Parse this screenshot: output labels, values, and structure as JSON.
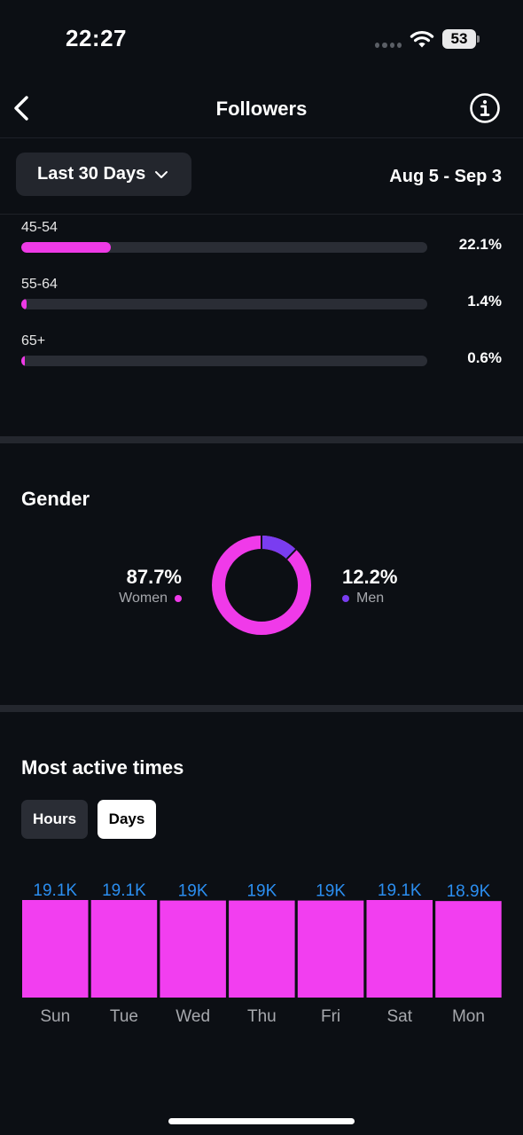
{
  "status_bar": {
    "time": "22:27",
    "battery": "53"
  },
  "header": {
    "title": "Followers",
    "back_icon": "chevron-left-icon",
    "info_icon": "info-circle-icon"
  },
  "range": {
    "selected": "Last 30 Days",
    "dates": "Aug 5 - Sep 3"
  },
  "age_groups": [
    {
      "label": "45-54",
      "value": "22.1%",
      "fraction": 0.221
    },
    {
      "label": "55-64",
      "value": "1.4%",
      "fraction": 0.014
    },
    {
      "label": "65+",
      "value": "0.6%",
      "fraction": 0.006
    }
  ],
  "gender": {
    "title": "Gender",
    "women": {
      "value": "87.7%",
      "label": "Women",
      "fraction": 0.877,
      "color": "#f03ae9"
    },
    "men": {
      "value": "12.2%",
      "label": "Men",
      "fraction": 0.122,
      "color": "#7a3df0"
    }
  },
  "active_times": {
    "title": "Most active times",
    "tabs": {
      "hours": "Hours",
      "days": "Days",
      "selected": "Days"
    }
  },
  "colors": {
    "accent": "#ee3ae6",
    "bar": "#f23ef0",
    "bar_label": "#2b8ef0",
    "background": "#0c0f14"
  },
  "chart_data": {
    "type": "bar",
    "categories": [
      "Sun",
      "Tue",
      "Wed",
      "Thu",
      "Fri",
      "Sat",
      "Mon"
    ],
    "values": [
      19.1,
      19.1,
      19.0,
      19.0,
      19.0,
      19.1,
      18.9
    ],
    "data_labels": [
      "19.1K",
      "19.1K",
      "19K",
      "19K",
      "19K",
      "19.1K",
      "18.9K"
    ],
    "units": "K"
  }
}
